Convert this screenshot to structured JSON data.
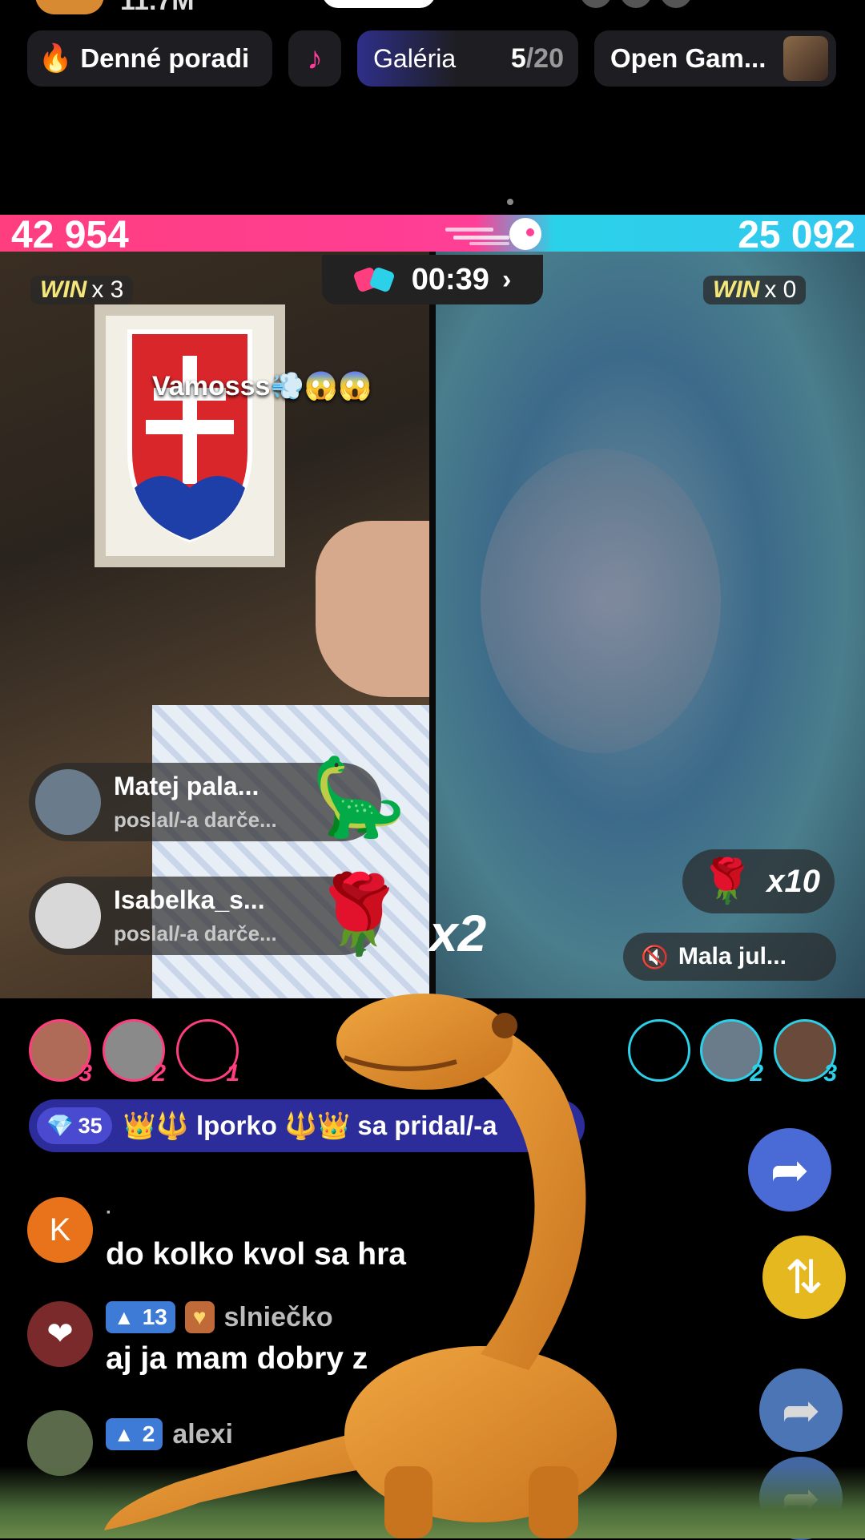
{
  "top_strip": {
    "stat": "11.7M"
  },
  "chips": {
    "daily": {
      "icon": "flame-icon",
      "label": "Denné poradi"
    },
    "tiktok": {
      "icon": "tiktok-note-icon"
    },
    "gallery": {
      "label": "Galéria",
      "count": "5",
      "total": "/20"
    },
    "game": {
      "label": "Open Gam..."
    }
  },
  "battle": {
    "score_left": "42 954",
    "score_right": "25 092",
    "colors": {
      "left": "#ff3e7f",
      "right": "#2bd1e8"
    },
    "timer": "00:39",
    "win_left": {
      "word": "WIN",
      "count": "x 3"
    },
    "win_right": {
      "word": "WIN",
      "count": "x 0"
    },
    "float_text": "Vamosss💨😱😱"
  },
  "gifts": [
    {
      "user": "Matej pala...",
      "sub": "poslal/-a darče...",
      "emoji": "🦕"
    },
    {
      "user": "Isabelka_s...",
      "sub": "poslal/-a darče...",
      "emoji": "🌹"
    }
  ],
  "combo": "x2",
  "rose_counter": {
    "emoji": "🌹",
    "count": "x10"
  },
  "muted_user": {
    "icon": "speaker-muted-icon",
    "label": "Mala jul..."
  },
  "supporters_left": [
    "3",
    "2",
    "1"
  ],
  "supporters_right": [
    "2",
    "3"
  ],
  "join": {
    "level": "35",
    "text": "👑🔱 lporko 🔱👑 sa pridal/-a"
  },
  "comments": [
    {
      "avatar": "K",
      "user": "·",
      "text": "do kolko kvol sa hra"
    },
    {
      "badge": "13",
      "user": "slniečko",
      "text": "aj ja mam dobry z"
    },
    {
      "badge": "2",
      "user": "alexi",
      "text": ""
    }
  ]
}
